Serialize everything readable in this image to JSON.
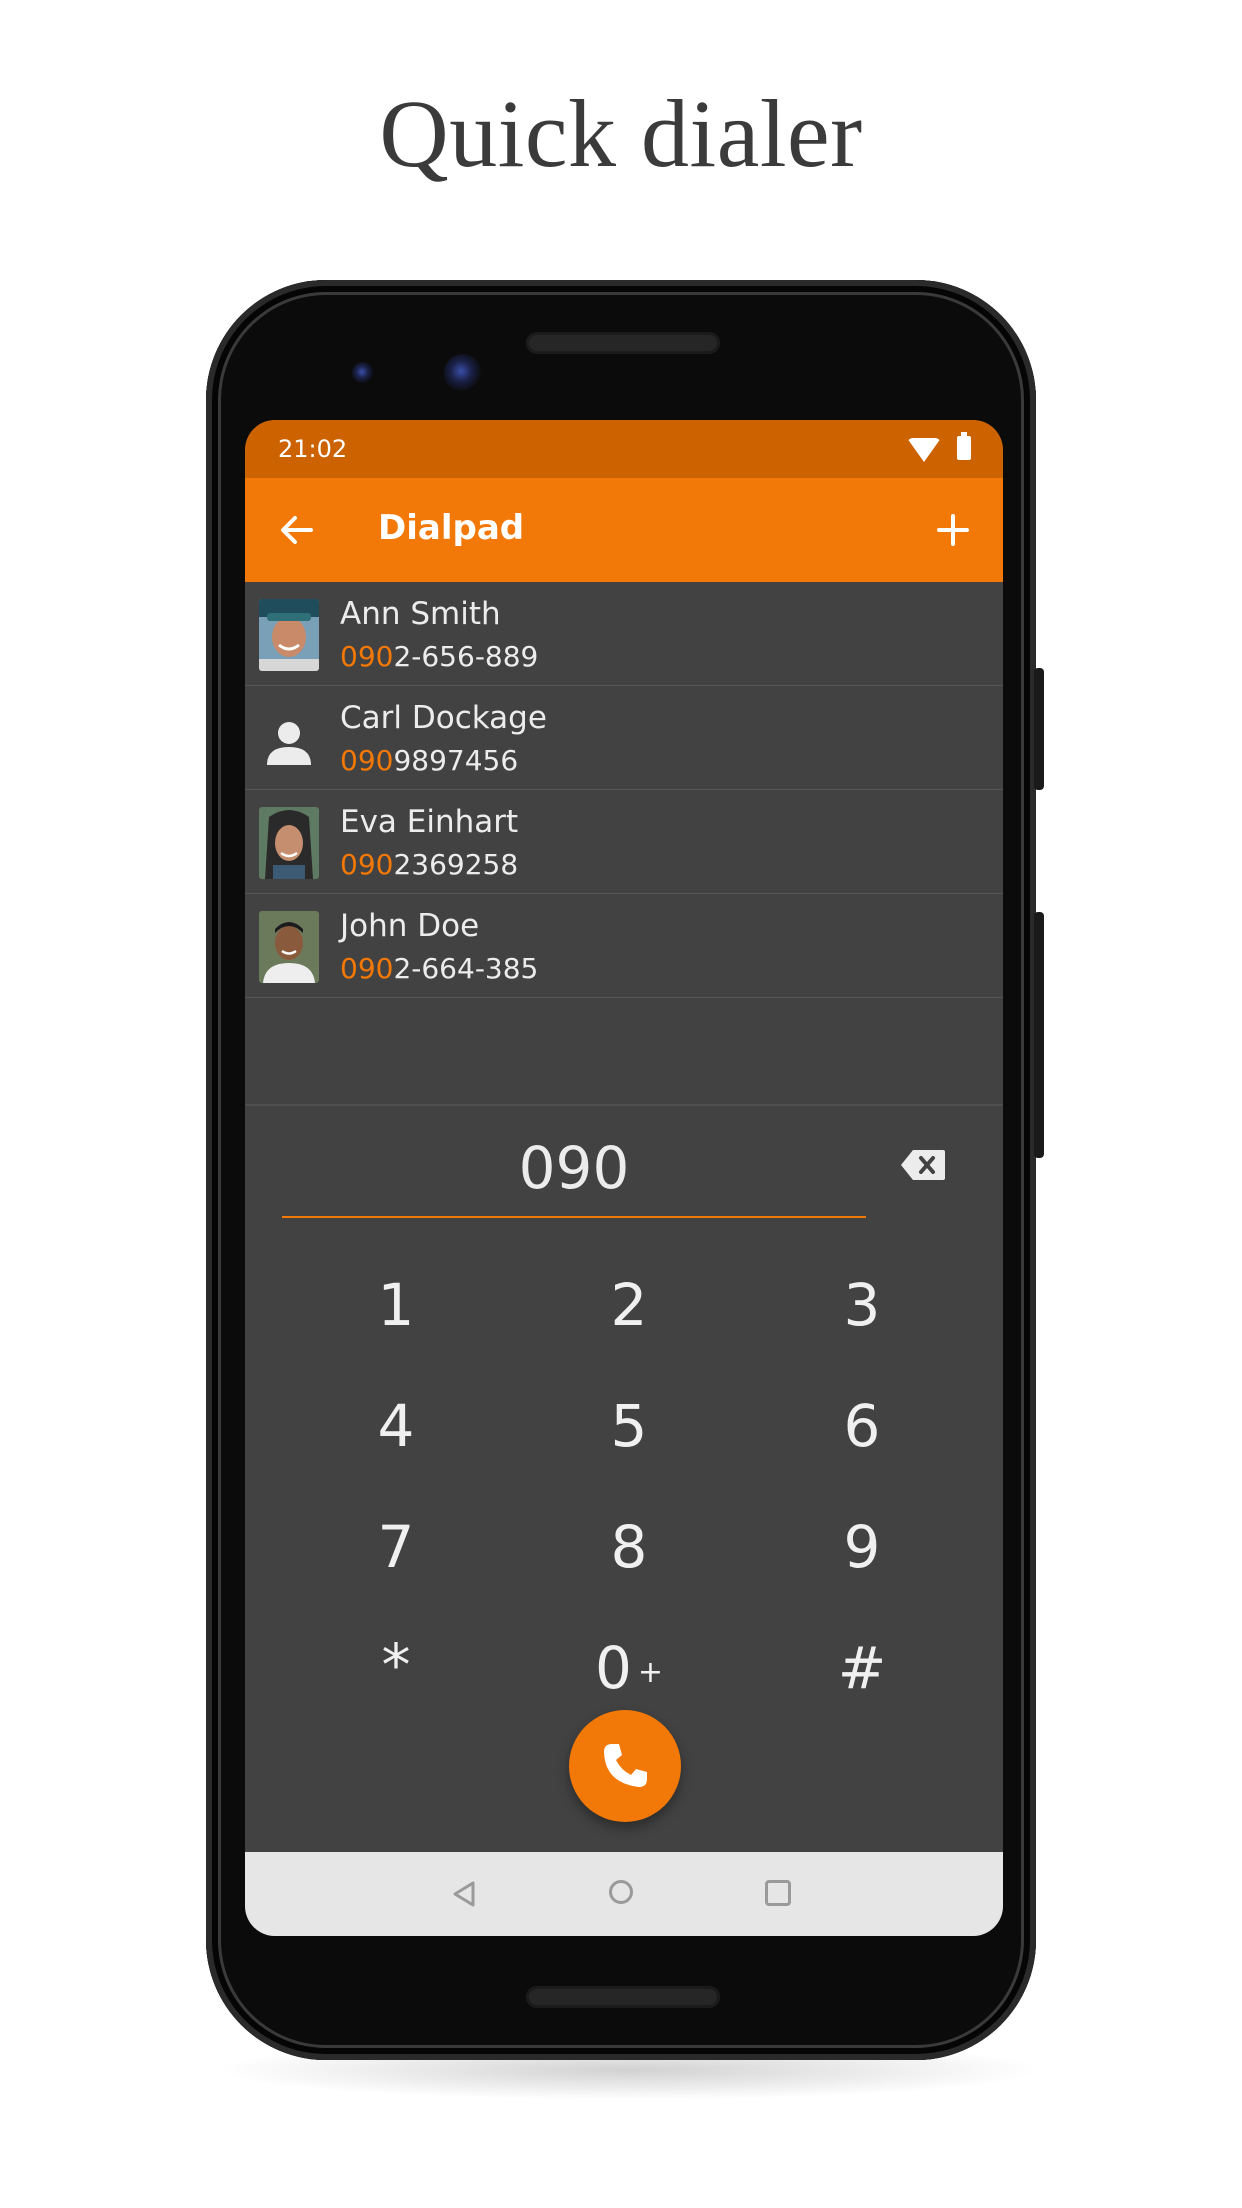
{
  "headline": "Quick dialer",
  "status_bar": {
    "time": "21:02",
    "icons": [
      "wifi-icon",
      "battery-icon"
    ]
  },
  "app_bar": {
    "title": "Dialpad",
    "left_icon": "back-arrow-icon",
    "right_icon": "add-icon"
  },
  "colors": {
    "accent": "#f27807",
    "status_bar": "#cc6300",
    "background": "#424242",
    "text": "#ececec"
  },
  "contacts": [
    {
      "name": "Ann Smith",
      "number_match": "090",
      "number_rest": "2-656-889",
      "avatar": "photo"
    },
    {
      "name": "Carl Dockage",
      "number_match": "090",
      "number_rest": "9897456",
      "avatar": "person-icon"
    },
    {
      "name": "Eva Einhart",
      "number_match": "090",
      "number_rest": "2369258",
      "avatar": "photo"
    },
    {
      "name": "John Doe",
      "number_match": "090",
      "number_rest": "2-664-385",
      "avatar": "photo"
    }
  ],
  "dial_entry": {
    "value": "090"
  },
  "keypad": [
    [
      "1",
      "2",
      "3"
    ],
    [
      "4",
      "5",
      "6"
    ],
    [
      "7",
      "8",
      "9"
    ],
    [
      "*",
      "0",
      "#"
    ]
  ],
  "zero_sub_label": "+",
  "call_button_icon": "phone-icon",
  "nav_bar_icons": [
    "nav-back-icon",
    "nav-home-icon",
    "nav-recents-icon"
  ]
}
